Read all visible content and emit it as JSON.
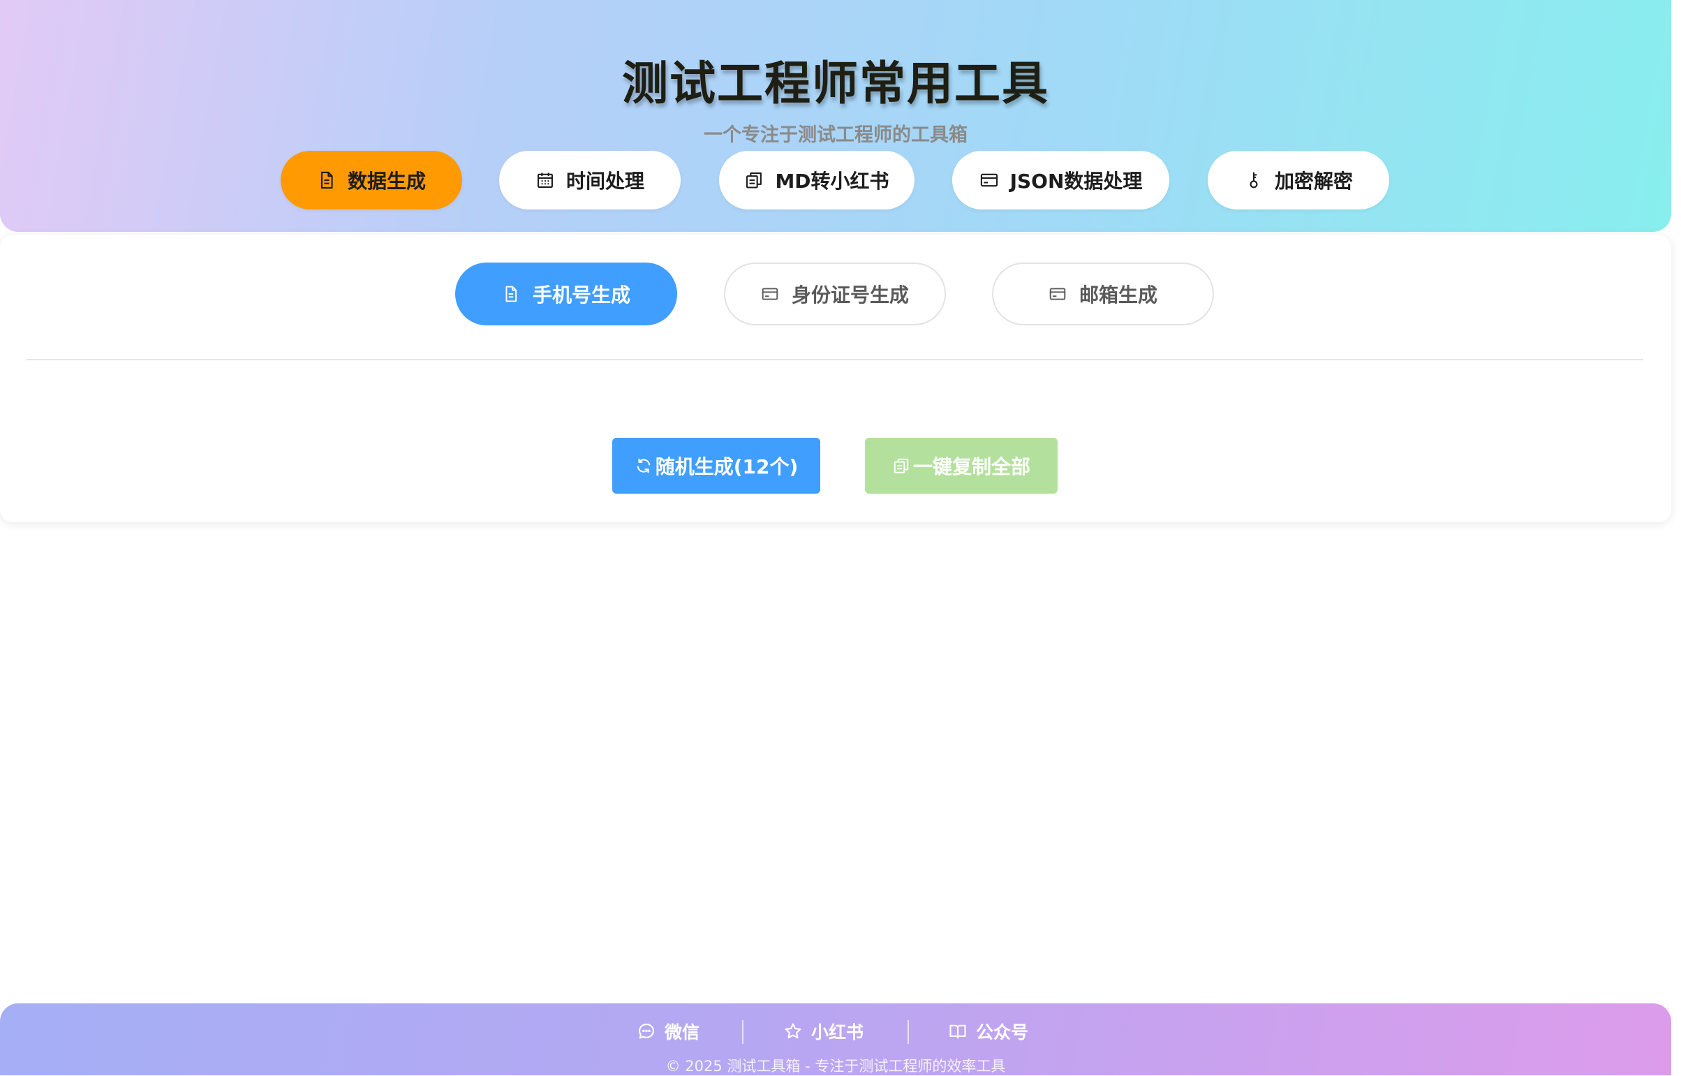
{
  "header": {
    "title": "测试工程师常用工具",
    "subtitle": "一个专注于测试工程师的工具箱"
  },
  "main_tabs": [
    {
      "label": "数据生成",
      "icon": "document-icon",
      "active": true
    },
    {
      "label": "时间处理",
      "icon": "calendar-icon",
      "active": false
    },
    {
      "label": "MD转小红书",
      "icon": "copy-icon",
      "active": false
    },
    {
      "label": "JSON数据处理",
      "icon": "card-icon",
      "active": false
    },
    {
      "label": "加密解密",
      "icon": "key-icon",
      "active": false
    }
  ],
  "sub_tabs": [
    {
      "label": "手机号生成",
      "icon": "document-icon",
      "active": true
    },
    {
      "label": "身份证号生成",
      "icon": "card-icon",
      "active": false
    },
    {
      "label": "邮箱生成",
      "icon": "card-icon",
      "active": false
    }
  ],
  "actions": {
    "generate_label": "随机生成(12个)",
    "copy_label": "一键复制全部"
  },
  "footer": {
    "links": [
      {
        "label": "微信",
        "icon": "chat-icon"
      },
      {
        "label": "小红书",
        "icon": "star-icon"
      },
      {
        "label": "公众号",
        "icon": "book-icon"
      }
    ],
    "copyright": "© 2025 测试工具箱 - 专注于测试工程师的效率工具"
  },
  "colors": {
    "accent_orange": "#ff9a02",
    "primary_blue": "#409eff",
    "success_light_green": "#b3e19d"
  }
}
